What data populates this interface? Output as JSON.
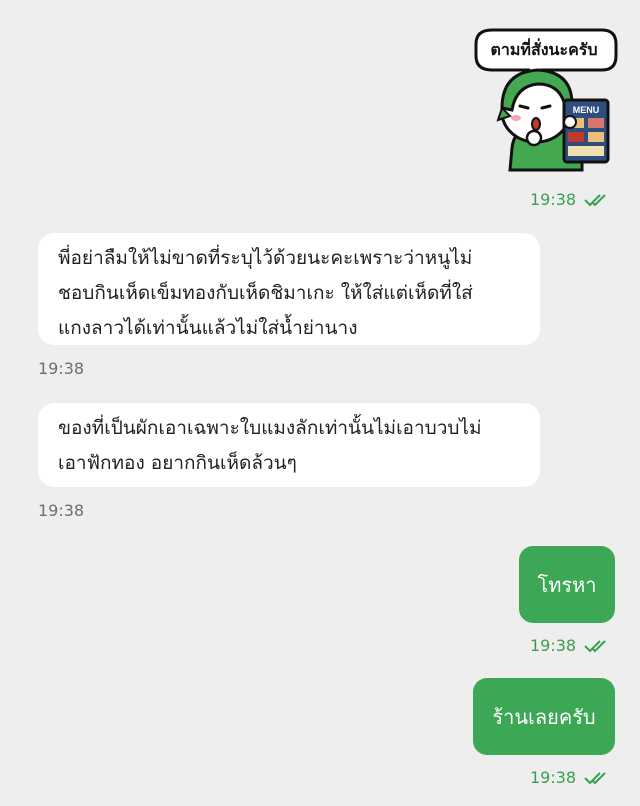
{
  "sticker": {
    "caption": "ตามที่สั่งนะครับ",
    "menu_label": "MENU",
    "time": "19:38"
  },
  "messages": [
    {
      "direction": "incoming",
      "lines": [
        "พี่อย่าลืมให้ไม่ขาดที่ระบุไว้ด้วยนะคะเพราะว่าหนูไม่",
        "ชอบกินเห็ดเข็มทองกับเห็ดชิมาเกะ ให้ใส่แต่เห็ดที่ใส่",
        "แกงลาวได้เท่านั้นแล้วไม่ใส่น้ำย่านาง"
      ],
      "time": "19:38"
    },
    {
      "direction": "incoming",
      "lines": [
        "ของที่เป็นผักเอาเฉพาะใบแมงลักเท่านั้นไม่เอาบวบไม่",
        "เอาฟักทอง อยากกินเห็ดล้วนๆ"
      ],
      "time": "19:38"
    },
    {
      "direction": "outgoing",
      "text": "โทรหา",
      "time": "19:38"
    },
    {
      "direction": "outgoing",
      "text": "ร้านเลยครับ",
      "time": "19:38"
    }
  ],
  "colors": {
    "background": "#eeeeee",
    "outgoing_bubble": "#3ca755",
    "incoming_bubble": "#ffffff",
    "read_ticks": "#3a9f53"
  },
  "icons": {
    "read_receipt": "double-check-icon"
  }
}
